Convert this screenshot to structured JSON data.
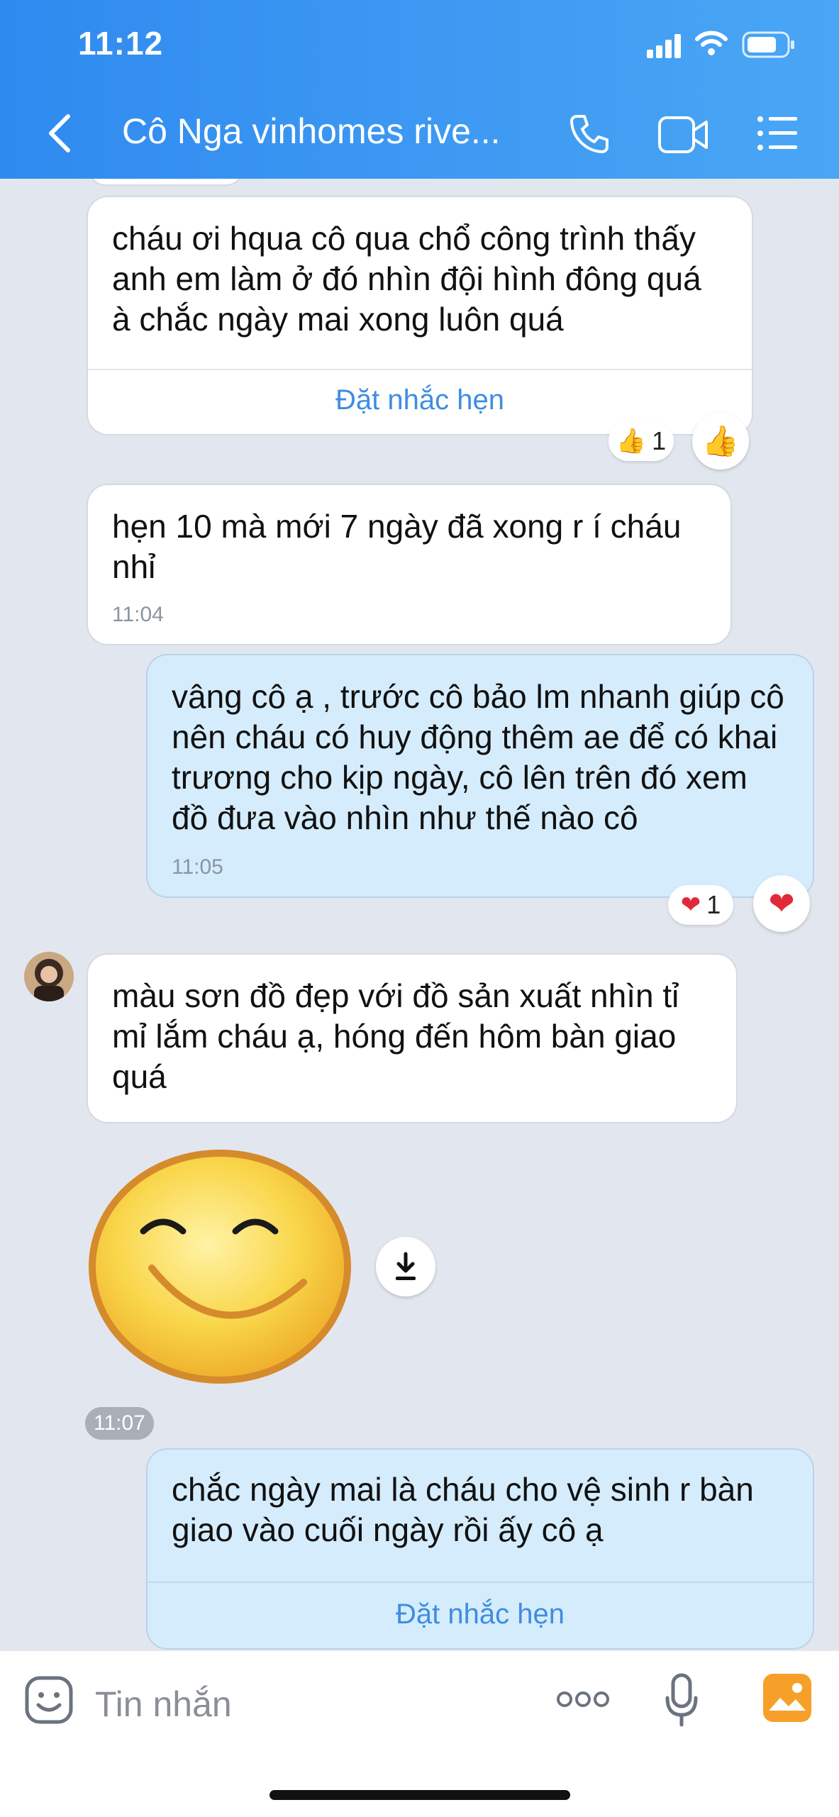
{
  "status_bar": {
    "time": "11:12"
  },
  "header": {
    "title": "Cô Nga vinhomes rive..."
  },
  "messages": [
    {
      "text": "cháu ơi hqua cô qua chổ công trình thấy anh em làm ở đó nhìn đội hình đông quá à chắc ngày mai xong luôn quá",
      "action": "Đặt nhắc hẹn",
      "reaction_count": "1"
    },
    {
      "text": "hẹn 10 mà mới 7 ngày đã xong r í cháu nhỉ",
      "time": "11:04"
    },
    {
      "text": "vâng cô ạ , trước cô bảo lm nhanh giúp cô nên cháu có huy động thêm ae để có khai trương cho kịp ngày, cô lên trên đó xem đồ đưa vào nhìn như thế nào cô",
      "time": "11:05",
      "reaction_count": "1"
    },
    {
      "text": "màu sơn đồ đẹp với đồ sản xuất nhìn tỉ mỉ lắm cháu ạ, hóng đến hôm bàn giao quá"
    },
    {
      "time": "11:07"
    },
    {
      "text": "chắc ngày mai là cháu cho vệ sinh r bàn giao vào cuối ngày rồi ấy cô ạ",
      "action": "Đặt nhắc hẹn"
    }
  ],
  "input": {
    "placeholder": "Tin nhắn",
    "more_label": "ooo"
  },
  "colors": {
    "header": "#2f8af0",
    "chat_bg": "#e2e7ef",
    "my_bubble": "#d5ecfc",
    "link": "#3f8de0"
  }
}
